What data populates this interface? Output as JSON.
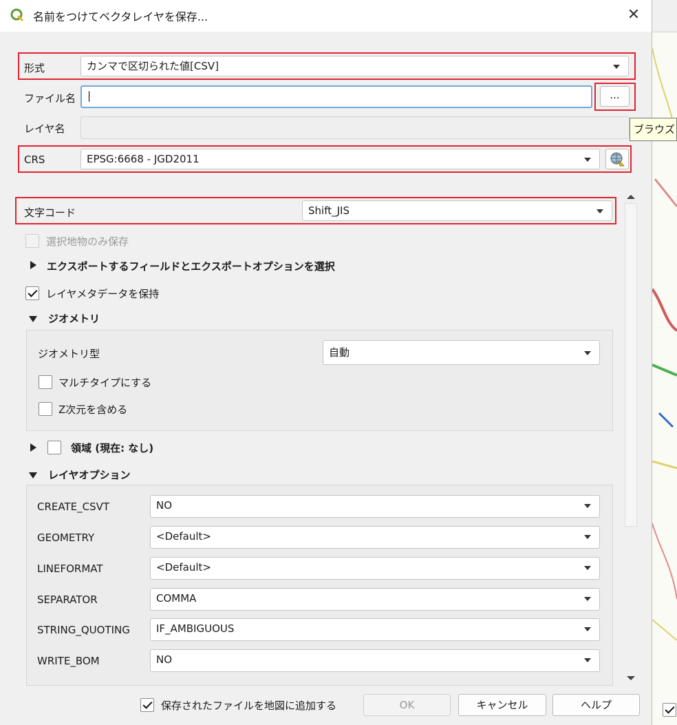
{
  "dialog": {
    "title": "名前をつけてベクタレイヤを保存..."
  },
  "form": {
    "format_label": "形式",
    "format_value": "カンマで区切られた値[CSV]",
    "filename_label": "ファイル名",
    "filename_value": "|",
    "browse_label": "...",
    "browse_tooltip": "ブラウズ",
    "layername_label": "レイヤ名",
    "crs_label": "CRS",
    "crs_value": "EPSG:6668 - JGD2011",
    "encoding_label": "文字コード",
    "encoding_value": "Shift_JIS",
    "selected_only_label": "選択地物のみ保存",
    "export_fields_label": "エクスポートするフィールドとエクスポートオプションを選択",
    "keep_metadata_label": "レイヤメタデータを保持"
  },
  "geometry": {
    "section_label": "ジオメトリ",
    "type_label": "ジオメトリ型",
    "type_value": "自動",
    "multitype_label": "マルチタイプにする",
    "z_label": "Z次元を含める"
  },
  "extent": {
    "label": "領域 (現在: なし)"
  },
  "layer_options": {
    "section_label": "レイヤオプション",
    "rows": [
      {
        "name": "CREATE_CSVT",
        "value": "NO"
      },
      {
        "name": "GEOMETRY",
        "value": "<Default>"
      },
      {
        "name": "LINEFORMAT",
        "value": "<Default>"
      },
      {
        "name": "SEPARATOR",
        "value": "COMMA"
      },
      {
        "name": "STRING_QUOTING",
        "value": "IF_AMBIGUOUS"
      },
      {
        "name": "WRITE_BOM",
        "value": "NO"
      }
    ]
  },
  "footer": {
    "add_to_map_label": "保存されたファイルを地図に追加する",
    "ok_label": "OK",
    "cancel_label": "キャンセル",
    "help_label": "ヘルプ"
  },
  "colors": {
    "highlight": "#e0232e",
    "focus": "#6fa8dc",
    "qgis_green": "#5b9b3c"
  }
}
